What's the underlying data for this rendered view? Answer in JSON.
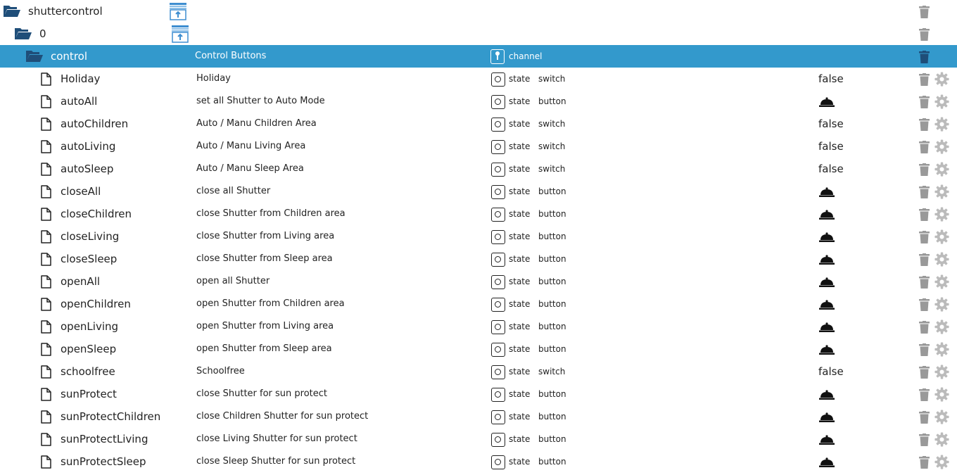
{
  "colors": {
    "selected_row_bg": "#3399cc",
    "icon_muted": "#999999",
    "folder_blue": "#1f4e79",
    "app_icon_blue": "#3e8ed0"
  },
  "icons": {
    "folder": "folder-open-icon",
    "file": "file-icon",
    "app": "shutter-adapter-icon",
    "channel": "channel-icon",
    "state": "state-icon",
    "button_value": "bell-icon",
    "delete": "trash-icon",
    "settings": "gear-icon"
  },
  "tree": {
    "adapter": {
      "name": "shuttercontrol"
    },
    "instance": {
      "name": "0"
    },
    "channel": {
      "name": "control",
      "description": "Control Buttons",
      "type": "channel"
    },
    "states": [
      {
        "name": "Holiday",
        "description": "Holiday",
        "type": "state",
        "role": "switch",
        "value": "false",
        "is_button": false
      },
      {
        "name": "autoAll",
        "description": "set all Shutter to Auto Mode",
        "type": "state",
        "role": "button",
        "value": "",
        "is_button": true
      },
      {
        "name": "autoChildren",
        "description": "Auto / Manu Children Area",
        "type": "state",
        "role": "switch",
        "value": "false",
        "is_button": false
      },
      {
        "name": "autoLiving",
        "description": "Auto / Manu Living Area",
        "type": "state",
        "role": "switch",
        "value": "false",
        "is_button": false
      },
      {
        "name": "autoSleep",
        "description": "Auto / Manu Sleep Area",
        "type": "state",
        "role": "switch",
        "value": "false",
        "is_button": false
      },
      {
        "name": "closeAll",
        "description": "close all Shutter",
        "type": "state",
        "role": "button",
        "value": "",
        "is_button": true
      },
      {
        "name": "closeChildren",
        "description": "close Shutter from Children area",
        "type": "state",
        "role": "button",
        "value": "",
        "is_button": true
      },
      {
        "name": "closeLiving",
        "description": "close Shutter from Living area",
        "type": "state",
        "role": "button",
        "value": "",
        "is_button": true
      },
      {
        "name": "closeSleep",
        "description": "close Shutter from Sleep area",
        "type": "state",
        "role": "button",
        "value": "",
        "is_button": true
      },
      {
        "name": "openAll",
        "description": "open all Shutter",
        "type": "state",
        "role": "button",
        "value": "",
        "is_button": true
      },
      {
        "name": "openChildren",
        "description": "open Shutter from Children area",
        "type": "state",
        "role": "button",
        "value": "",
        "is_button": true
      },
      {
        "name": "openLiving",
        "description": "open Shutter from Living area",
        "type": "state",
        "role": "button",
        "value": "",
        "is_button": true
      },
      {
        "name": "openSleep",
        "description": "open Shutter from Sleep area",
        "type": "state",
        "role": "button",
        "value": "",
        "is_button": true
      },
      {
        "name": "schoolfree",
        "description": "Schoolfree",
        "type": "state",
        "role": "switch",
        "value": "false",
        "is_button": false
      },
      {
        "name": "sunProtect",
        "description": "close Shutter for sun protect",
        "type": "state",
        "role": "button",
        "value": "",
        "is_button": true
      },
      {
        "name": "sunProtectChildren",
        "description": "close Children Shutter for sun protect",
        "type": "state",
        "role": "button",
        "value": "",
        "is_button": true
      },
      {
        "name": "sunProtectLiving",
        "description": "close Living Shutter for sun protect",
        "type": "state",
        "role": "button",
        "value": "",
        "is_button": true
      },
      {
        "name": "sunProtectSleep",
        "description": "close Sleep Shutter for sun protect",
        "type": "state",
        "role": "button",
        "value": "",
        "is_button": true
      }
    ]
  }
}
